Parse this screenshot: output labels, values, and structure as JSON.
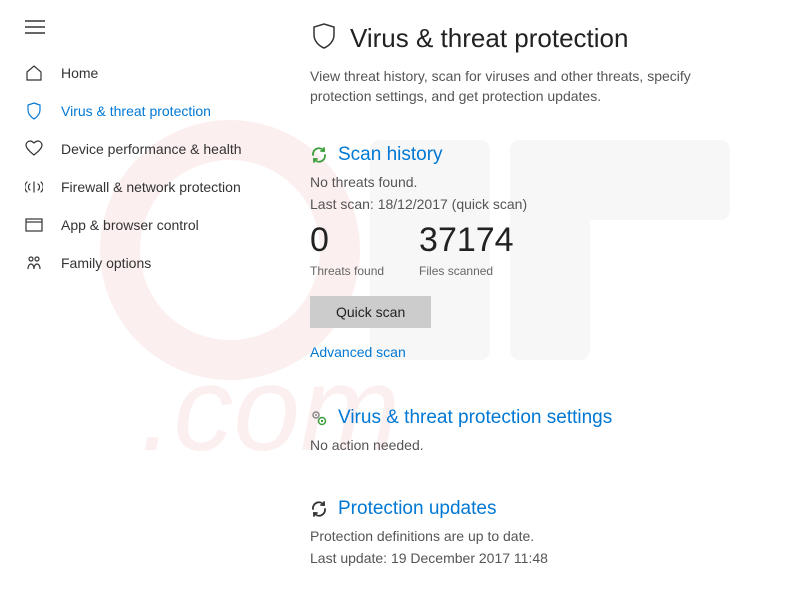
{
  "sidebar": {
    "items": [
      {
        "label": "Home",
        "active": false
      },
      {
        "label": "Virus & threat protection",
        "active": true
      },
      {
        "label": "Device performance & health",
        "active": false
      },
      {
        "label": "Firewall & network protection",
        "active": false
      },
      {
        "label": "App & browser control",
        "active": false
      },
      {
        "label": "Family options",
        "active": false
      }
    ]
  },
  "header": {
    "title": "Virus & threat protection",
    "description": "View threat history, scan for viruses and other threats, specify protection settings, and get protection updates."
  },
  "scan_history": {
    "title": "Scan history",
    "no_threats": "No threats found.",
    "last_scan": "Last scan: 18/12/2017 (quick scan)",
    "threats_count": "0",
    "threats_label": "Threats found",
    "files_count": "37174",
    "files_label": "Files scanned",
    "quick_scan_btn": "Quick scan",
    "advanced_link": "Advanced scan"
  },
  "settings_section": {
    "title": "Virus & threat protection settings",
    "status": "No action needed."
  },
  "updates_section": {
    "title": "Protection updates",
    "status": "Protection definitions are up to date.",
    "last_update": "Last update: 19 December 2017 11:48"
  },
  "colors": {
    "accent": "#0078d4",
    "arrow": "#e85a1a"
  }
}
